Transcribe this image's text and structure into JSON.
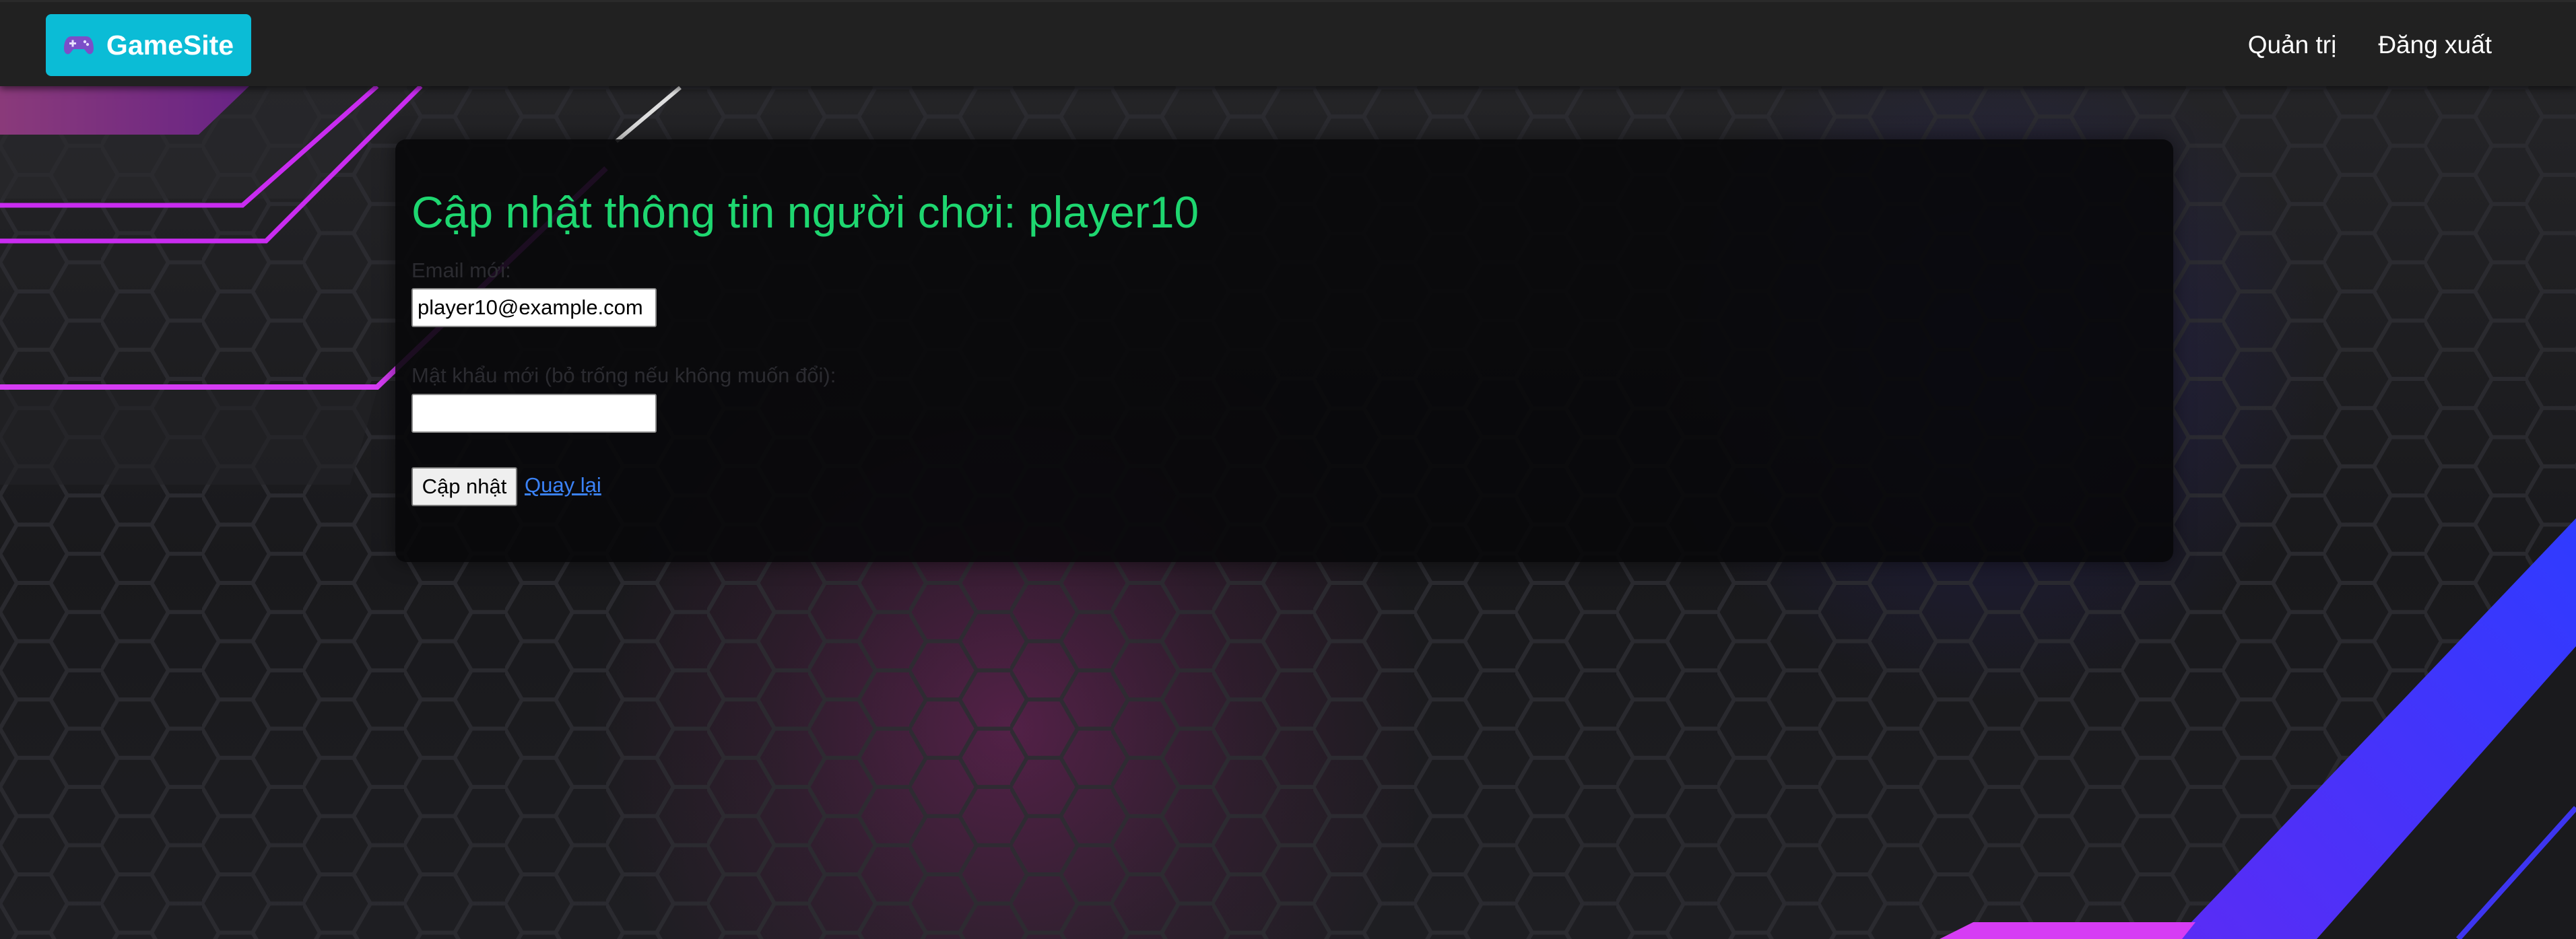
{
  "navbar": {
    "brand_label": "GameSite",
    "brand_icon": "gamepad-icon",
    "links": [
      {
        "label": "Quản trị"
      },
      {
        "label": "Đăng xuất"
      }
    ]
  },
  "form": {
    "title": "Cập nhật thông tin người chơi: player10",
    "email_label": "Email mới:",
    "email_value": "player10@example.com",
    "password_label": "Mật khẩu mới (bỏ trống nếu không muốn đổi):",
    "password_value": "",
    "submit_label": "Cập nhật",
    "back_label": "Quay lại"
  },
  "colors": {
    "brand_bg": "#0bbcd6",
    "navbar_bg": "#212121",
    "title": "#1ed770",
    "link": "#3b82f6",
    "accent_magenta": "#e040fb",
    "accent_blue": "#3d35f0"
  }
}
